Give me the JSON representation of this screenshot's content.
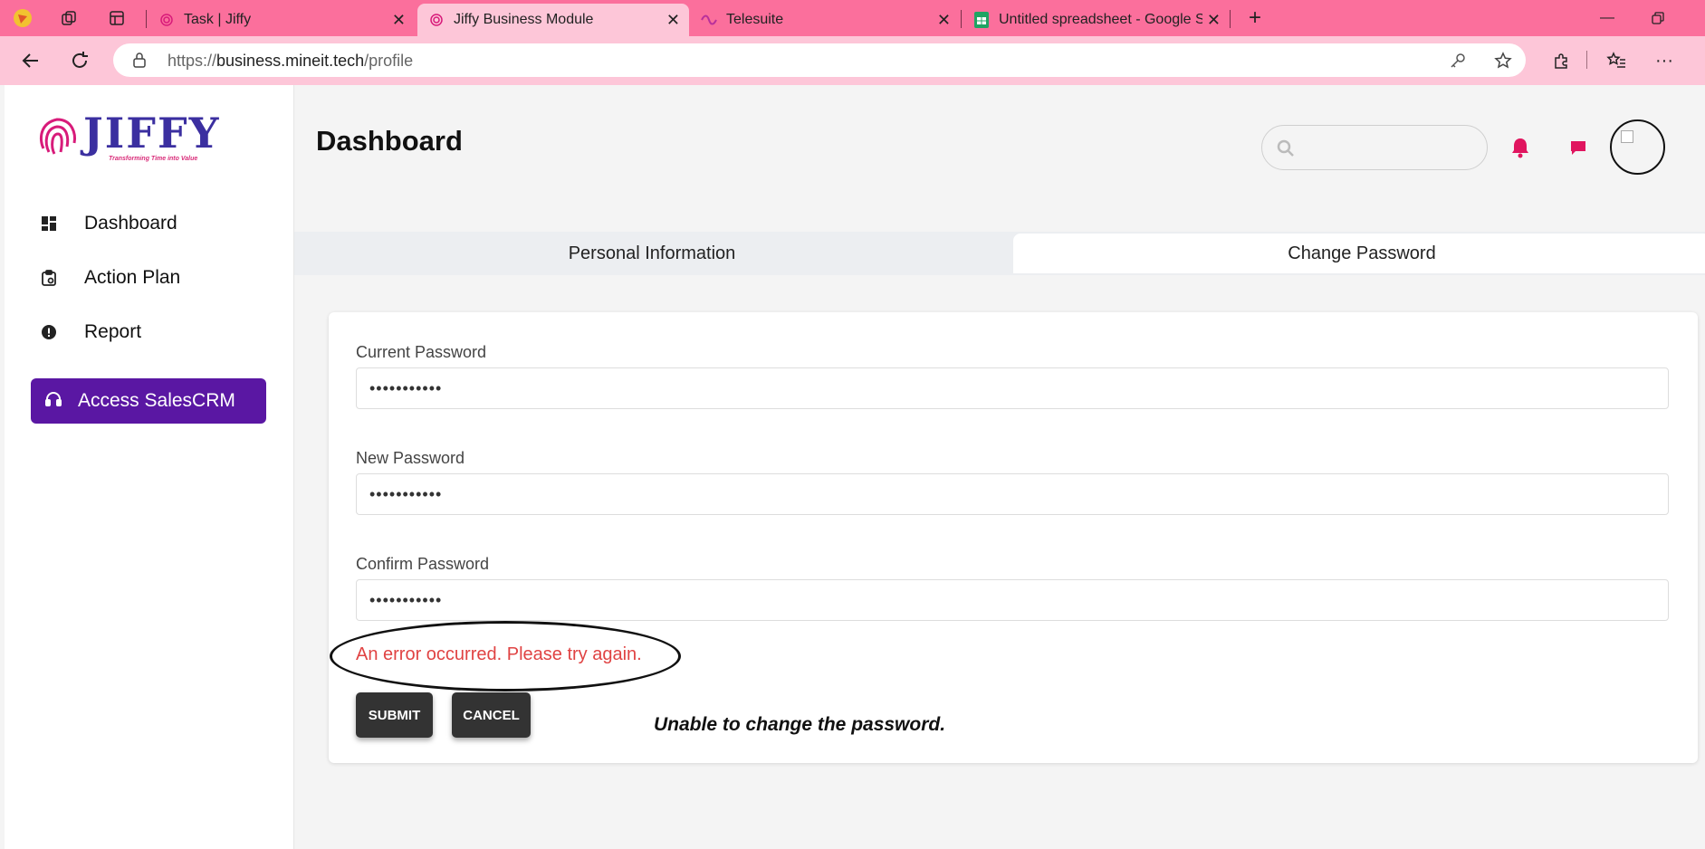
{
  "browser": {
    "tabs": [
      {
        "title": "Task | Jiffy"
      },
      {
        "title": "Jiffy Business Module"
      },
      {
        "title": "Telesuite"
      },
      {
        "title": "Untitled spreadsheet - Google Sh"
      }
    ],
    "url_prefix": "https://",
    "url_host": "business.mineit.tech",
    "url_path": "/profile"
  },
  "brand": {
    "name": "JIFFY",
    "tagline": "Transforming Time into Value"
  },
  "sidebar": {
    "items": [
      {
        "label": "Dashboard",
        "icon": "dashboard-icon"
      },
      {
        "label": "Action Plan",
        "icon": "clipboard-icon"
      },
      {
        "label": "Report",
        "icon": "alert-icon"
      }
    ],
    "crm_button": {
      "label": "Access SalesCRM",
      "icon": "headset-icon"
    }
  },
  "header": {
    "title": "Dashboard",
    "search_placeholder": ""
  },
  "profile_tabs": [
    {
      "label": "Personal Information",
      "active": false
    },
    {
      "label": "Change Password",
      "active": true
    }
  ],
  "form": {
    "current_password": {
      "label": "Current Password",
      "value": "•••••••••••"
    },
    "new_password": {
      "label": "New Password",
      "value": "•••••••••••"
    },
    "confirm_password": {
      "label": "Confirm Password",
      "value": "•••••••••••"
    },
    "error": "An error occurred. Please try again.",
    "submit_label": "SUBMIT",
    "cancel_label": "CANCEL"
  },
  "annotation": {
    "note": "Unable to change the password."
  },
  "colors": {
    "tabbar": "#fb6f9c",
    "addressbar": "#fdc6d8",
    "accent": "#5a17a3",
    "error": "#e04343",
    "icon_pink": "#e0155f"
  }
}
